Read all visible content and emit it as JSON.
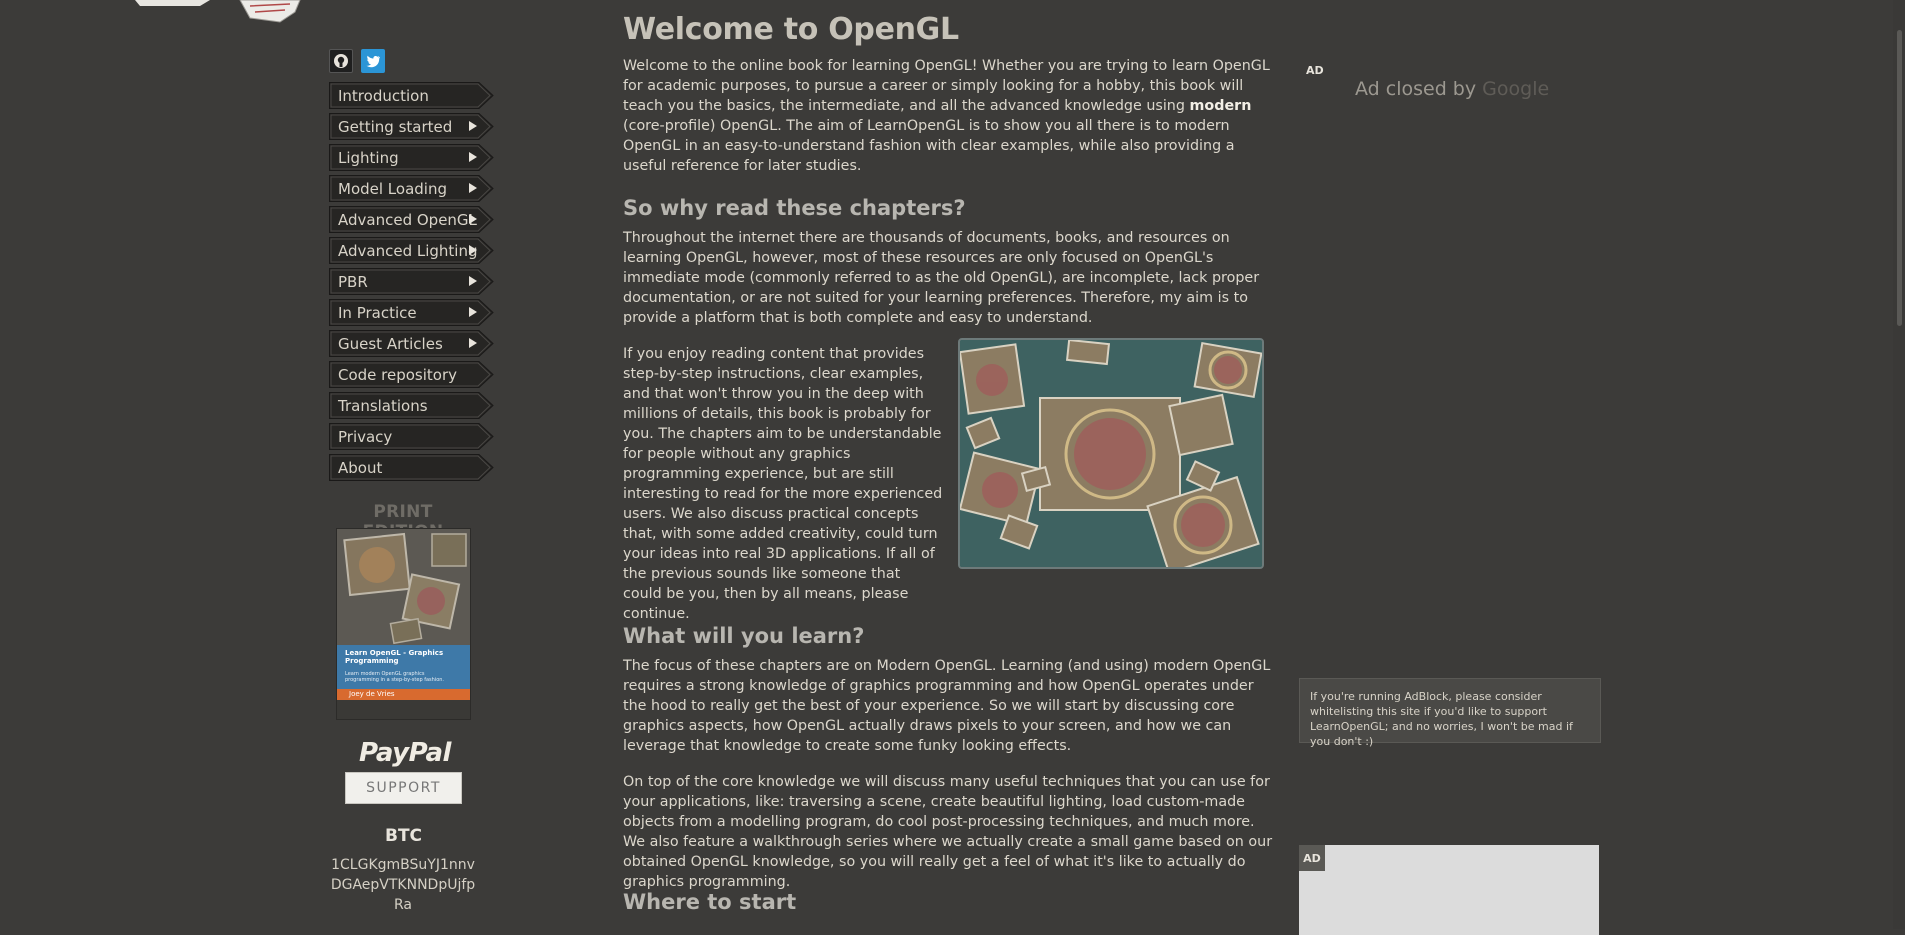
{
  "social": {
    "github_icon": "github-icon",
    "twitter_icon": "twitter-icon"
  },
  "menu": [
    {
      "label": "Introduction",
      "has_arrow": false
    },
    {
      "label": "Getting started",
      "has_arrow": true
    },
    {
      "label": "Lighting",
      "has_arrow": true
    },
    {
      "label": "Model Loading",
      "has_arrow": true
    },
    {
      "label": "Advanced OpenGL",
      "has_arrow": true
    },
    {
      "label": "Advanced Lighting",
      "has_arrow": true
    },
    {
      "label": "PBR",
      "has_arrow": true
    },
    {
      "label": "In Practice",
      "has_arrow": true
    },
    {
      "label": "Guest Articles",
      "has_arrow": true
    },
    {
      "label": "Code repository",
      "has_arrow": false
    },
    {
      "label": "Translations",
      "has_arrow": false
    },
    {
      "label": "Privacy",
      "has_arrow": false
    },
    {
      "label": "About",
      "has_arrow": false
    }
  ],
  "print_edition": {
    "title": "PRINT EDITION",
    "book_title": "Learn OpenGL - Graphics Programming",
    "book_subtitle": "Learn modern OpenGL graphics programming in a step-by-step fashion.",
    "book_author": "Joey de Vries"
  },
  "donate": {
    "paypal": "PayPal",
    "support": "SUPPORT",
    "btc_title": "BTC",
    "btc_address": "1CLGKgmBSuYJ1nnvDGAepVTKNNDpUjfpRa"
  },
  "main": {
    "title": "Welcome to OpenGL",
    "intro_before": "Welcome to the online book for learning OpenGL! Whether you are trying to learn OpenGL for academic purposes, to pursue a career or simply looking for a hobby, this book will teach you the basics, the intermediate, and all the advanced knowledge using ",
    "intro_bold": "modern",
    "intro_after": " (core-profile) OpenGL. The aim of LearnOpenGL is to show you all there is to modern OpenGL in an easy-to-understand fashion with clear examples, while also providing a useful reference for later studies.",
    "h_why": "So why read these chapters?",
    "p_why": "Throughout the internet there are thousands of documents, books, and resources on learning OpenGL, however, most of these resources are only focused on OpenGL's immediate mode (commonly referred to as the old OpenGL), are incomplete, lack proper documentation, or are not suited for your learning preferences. Therefore, my aim is to provide a platform that is both complete and easy to understand.",
    "p_enjoy": "If you enjoy reading content that provides step-by-step instructions, clear examples, and that won't throw you in the deep with millions of details, this book is probably for you. The chapters aim to be understandable for people without any graphics programming experience, but are still interesting to read for the more experienced users. We also discuss practical concepts that, with some added creativity, could turn your ideas into real 3D applications. If all of the previous sounds like someone that could be you, then by all means, please continue.",
    "h_learn": "What will you learn?",
    "p_learn1": "The focus of these chapters are on Modern OpenGL. Learning (and using) modern OpenGL requires a strong knowledge of graphics programming and how OpenGL operates under the hood to really get the best of your experience. So we will start by discussing core graphics aspects, how OpenGL actually draws pixels to your screen, and how we can leverage that knowledge to create some funky looking effects.",
    "p_learn2": "On top of the core knowledge we will discuss many useful techniques that you can use for your applications, like: traversing a scene, create beautiful lighting, load custom-made objects from a modelling program, do cool post-processing techniques, and much more. We also feature a walkthrough series where we actually create a small game based on our obtained OpenGL knowledge, so you will really get a feel of what it's like to actually do graphics programming.",
    "h_start": "Where to start"
  },
  "ads": {
    "tag": "AD",
    "closed_text": "Ad closed by",
    "closed_brand": "Google",
    "adblock_note": "If you're running AdBlock, please consider whitelisting this site if you'd like to support LearnOpenGL; and no worries, I won't be mad if you don't :)"
  },
  "colors": {
    "background": "#3c3b39",
    "text": "#dcd7cc",
    "heading": "#c6c2b8",
    "twitter": "#2b95d6"
  }
}
